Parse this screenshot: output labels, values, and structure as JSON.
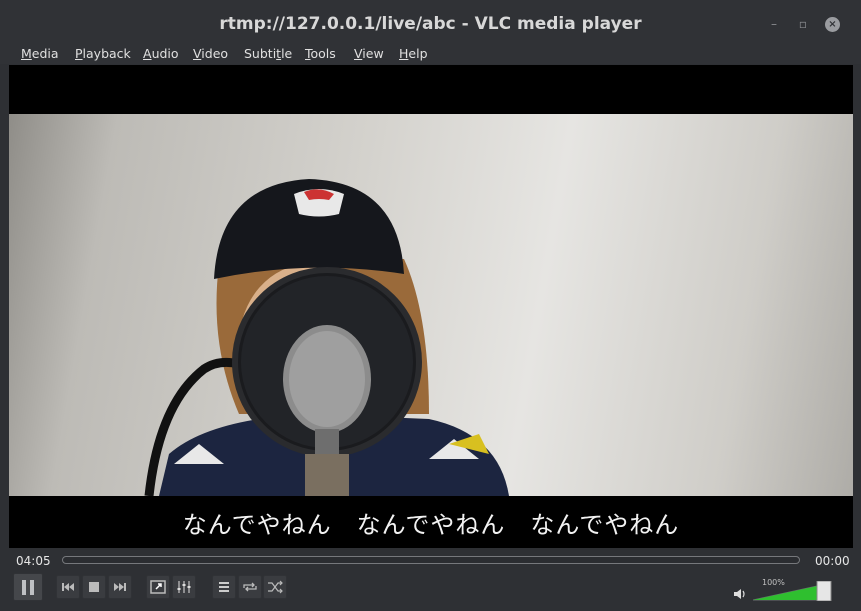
{
  "window": {
    "title": "rtmp://127.0.0.1/live/abc - VLC media player",
    "minimize_glyph": "–",
    "restore_glyph": "▫",
    "close_glyph": "×"
  },
  "menu": {
    "items": [
      {
        "label": "Media",
        "accel": "M",
        "rest": "edia"
      },
      {
        "label": "Playback",
        "accel": "P",
        "rest": "layback"
      },
      {
        "label": "Audio",
        "accel": "A",
        "rest": "udio"
      },
      {
        "label": "Video",
        "accel": "V",
        "rest": "ideo"
      },
      {
        "label": "Subtitle",
        "accel": "S",
        "rest": "ubtitle",
        "accel_index": 5
      },
      {
        "label": "Tools",
        "accel": "T",
        "rest": "ools"
      },
      {
        "label": "View",
        "accel": "V",
        "rest": "iew"
      },
      {
        "label": "Help",
        "accel": "H",
        "rest": "elp"
      }
    ]
  },
  "video": {
    "subtitle": "なんでやねん　なんでやねん　なんでやねん"
  },
  "seek": {
    "elapsed": "04:05",
    "remaining": "00:00",
    "progress": 0
  },
  "controls": {
    "play_pause_icon": "pause-icon",
    "prev_icon": "skip-previous-icon",
    "stop_icon": "stop-icon",
    "next_icon": "skip-next-icon",
    "fullscreen_icon": "fullscreen-icon",
    "extended_settings_icon": "equalizer-sliders-icon",
    "playlist_icon": "playlist-icon",
    "loop_icon": "loop-icon",
    "shuffle_icon": "shuffle-icon"
  },
  "volume": {
    "percent_label": "100%",
    "level": 1.0,
    "fill_color": "#2fbf2f"
  }
}
